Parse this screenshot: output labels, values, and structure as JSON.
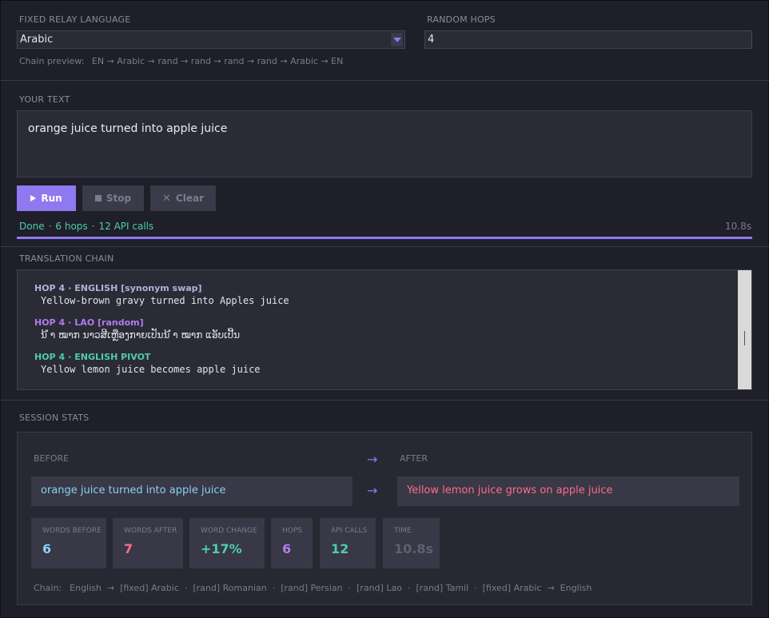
{
  "relay": {
    "label": "FIXED RELAY LANGUAGE",
    "value": "Arabic"
  },
  "hops": {
    "label": "RANDOM HOPS",
    "value": "4"
  },
  "chain_preview": {
    "label": "Chain preview:",
    "value": "EN → Arabic → rand → rand → rand → rand → Arabic → EN"
  },
  "your_text": {
    "label": "YOUR TEXT",
    "value": "orange juice turned into apple juice"
  },
  "buttons": {
    "run": "Run",
    "stop": "Stop",
    "clear": "Clear"
  },
  "status": {
    "state": "Done",
    "hops": "6 hops",
    "calls": "12 API calls",
    "elapsed": "10.8s",
    "progress": 1.0
  },
  "chain": {
    "label": "TRANSLATION CHAIN",
    "entries": [
      {
        "hop": "HOP 4",
        "lang": "ENGLISH",
        "tag": "[synonym swap]",
        "text": "Yellow-brown gravy turned into Apples juice",
        "color": "#b6b0d8"
      },
      {
        "hop": "HOP 4",
        "lang": "LAO",
        "tag": "[random]",
        "text": "ນ້ ໍາ ໝາກ ນາວສີເຫຼືອງກາຍເປັນນ້ ໍາ ໝາກ ແອັບເປີ້ນ",
        "color": "#b27cf0"
      },
      {
        "hop": "HOP 4",
        "lang": "ENGLISH PIVOT",
        "tag": "",
        "text": "Yellow lemon juice becomes apple juice",
        "color": "#4ecdab"
      }
    ]
  },
  "stats": {
    "label": "SESSION STATS",
    "before_label": "BEFORE",
    "after_label": "AFTER",
    "arrow": "→",
    "before_text": "orange juice turned into apple juice",
    "after_text": "Yellow lemon juice grows on apple juice",
    "before_color": "#8ad0f4",
    "after_color": "#ff6b8b",
    "cards": [
      {
        "key": "WORDS BEFORE",
        "value": "6",
        "color": "#8ad0f4"
      },
      {
        "key": "WORDS AFTER",
        "value": "7",
        "color": "#ff6b8b"
      },
      {
        "key": "WORD CHANGE",
        "value": "+17%",
        "color": "#4ecdab"
      },
      {
        "key": "HOPS",
        "value": "6",
        "color": "#b27cf0"
      },
      {
        "key": "API CALLS",
        "value": "12",
        "color": "#4ecdab"
      },
      {
        "key": "TIME",
        "value": "10.8s",
        "color": "#5f5f70"
      }
    ],
    "chain_label": "Chain:",
    "chain_value": "English  →  [fixed] Arabic  ·  [rand] Romanian  ·  [rand] Persian  ·  [rand] Lao  ·  [rand] Tamil  ·  [fixed] Arabic  →  English"
  },
  "colors": {
    "accent": "#8f79f0",
    "success": "#4ecdab",
    "background": "#1f1f29"
  }
}
